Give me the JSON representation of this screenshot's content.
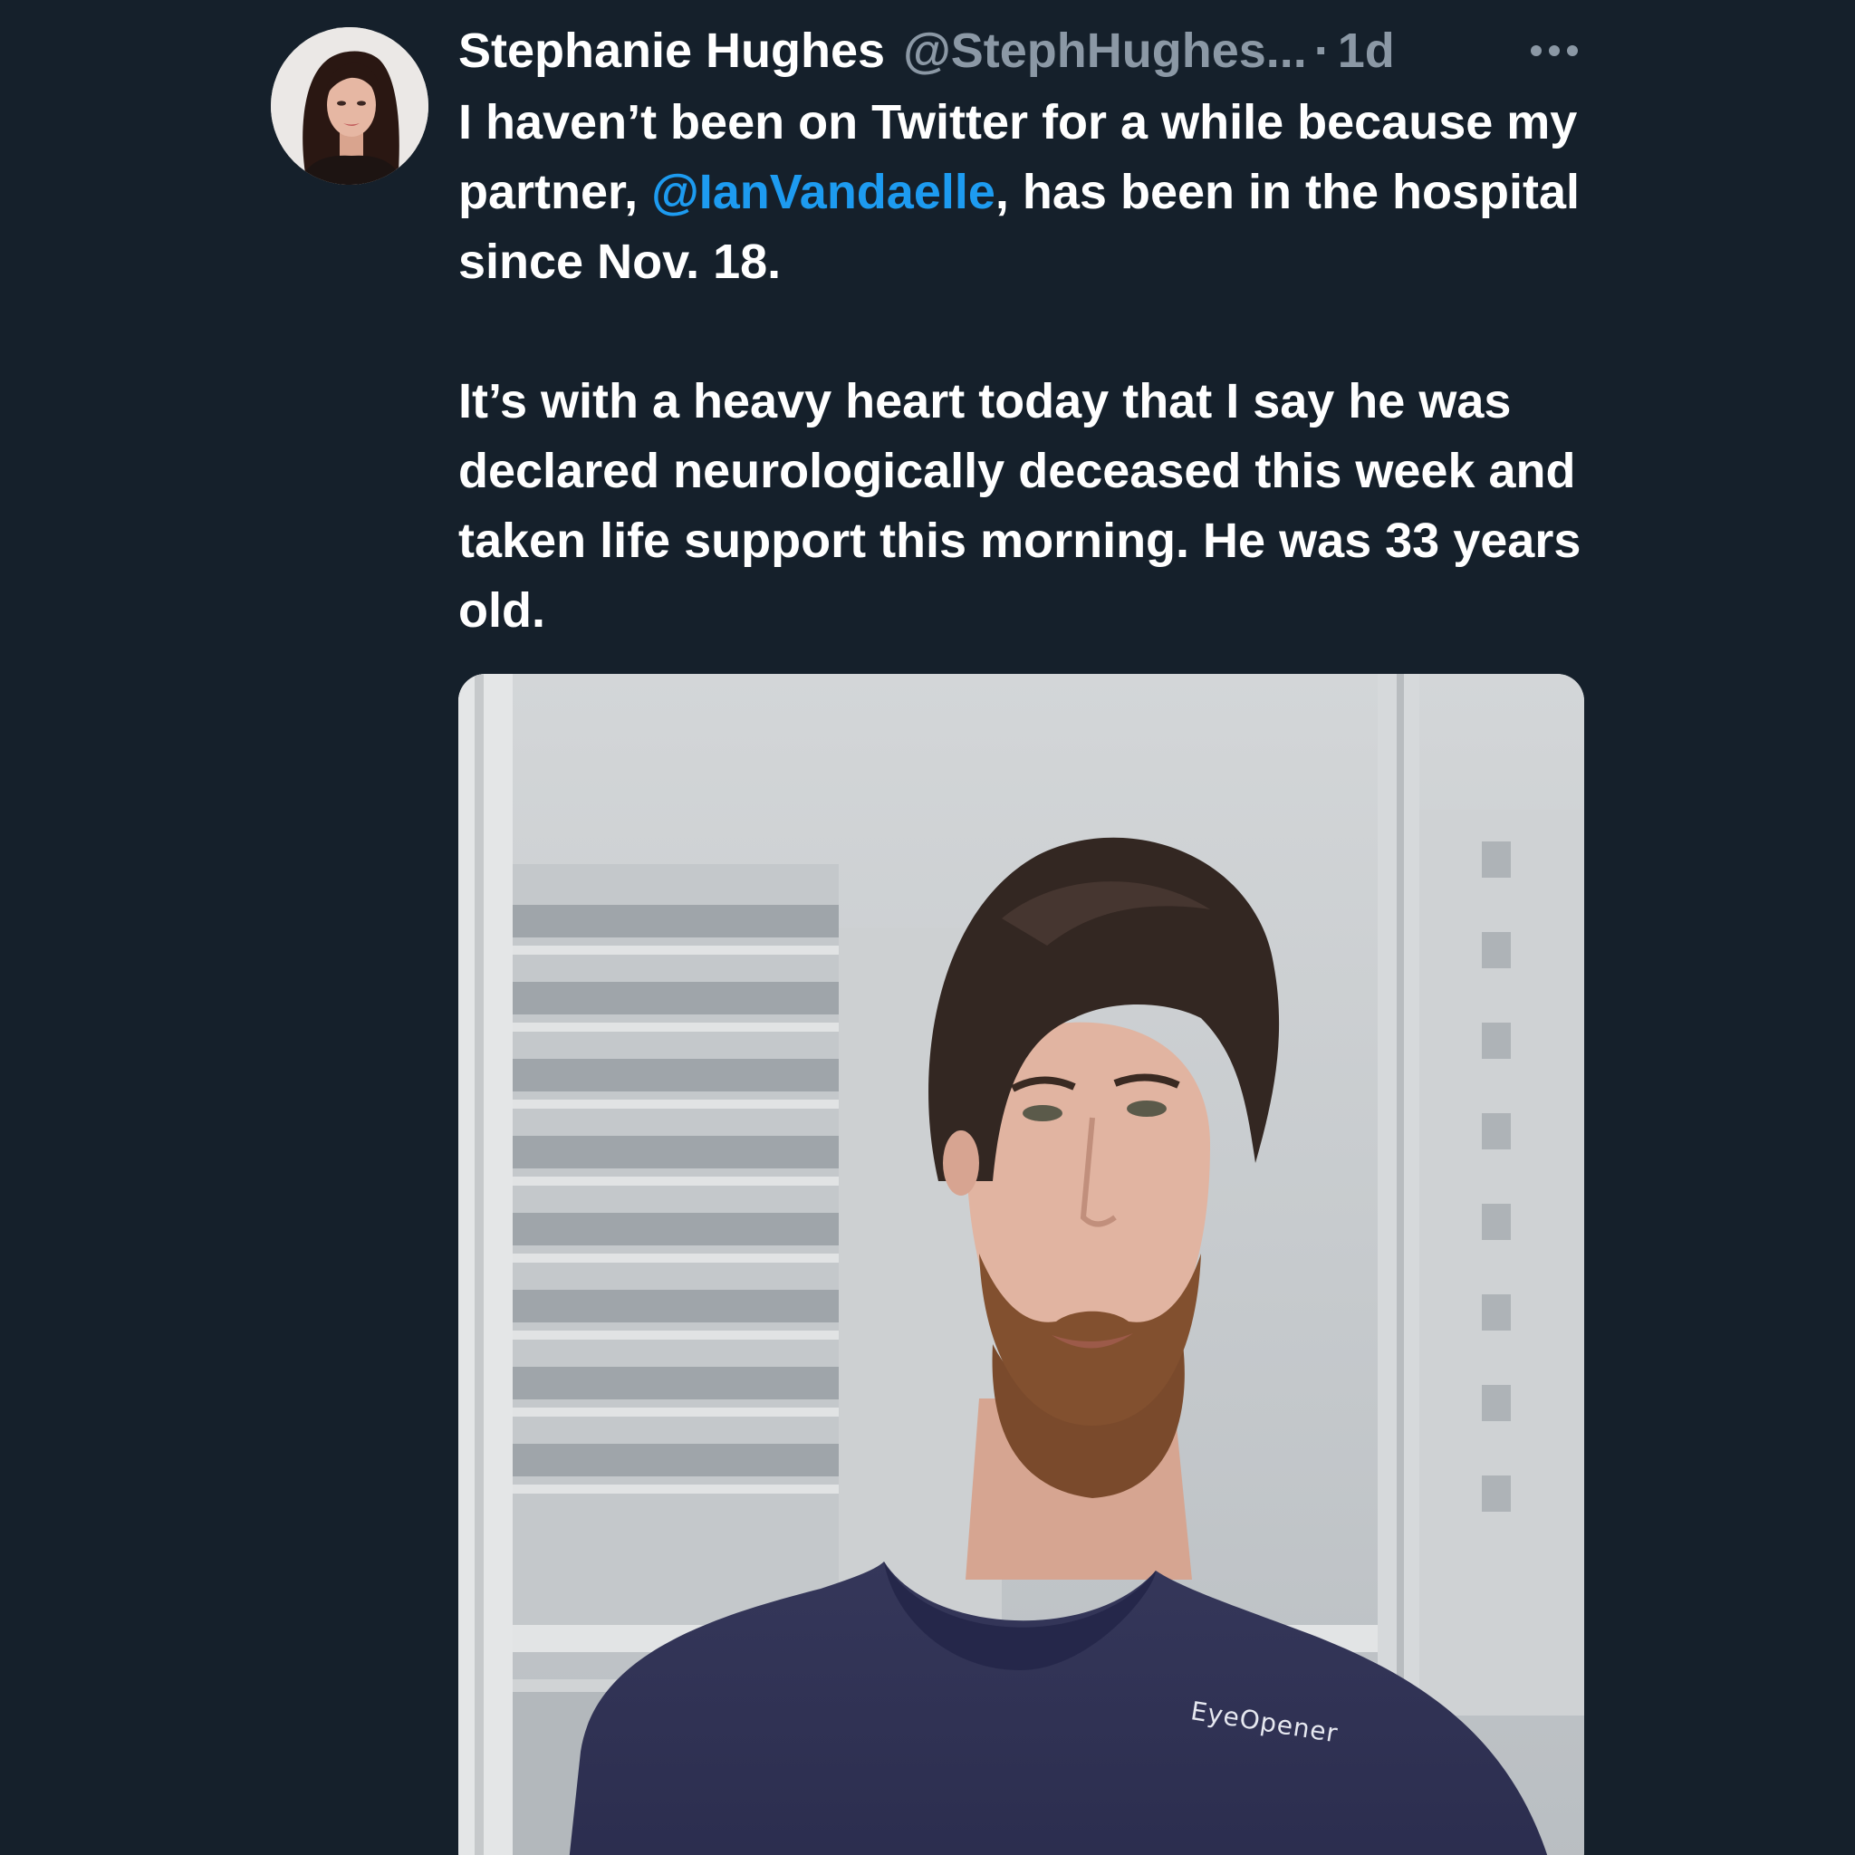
{
  "tweet": {
    "author": {
      "display_name": "Stephanie Hughes",
      "handle": "@StephHughes...",
      "separator": "·",
      "time": "1d",
      "avatar_icon": "profile-photo-woman"
    },
    "more_icon": "more-options-icon",
    "text": {
      "line1_part1": "I haven’t been on Twitter for a while because my partner, ",
      "mention": "@IanVandaelle",
      "line1_part2": ", has been in the hospital since Nov. 18.",
      "paragraph2": "It’s with a heavy heart today that I say he was declared neurologically deceased this week and taken life support this morning. He was 33 years old."
    },
    "media": {
      "shirt_text": "EyeOpener"
    }
  },
  "colors": {
    "background": "#15202b",
    "text_primary": "#ffffff",
    "text_secondary": "#8b98a5",
    "link": "#1d9bf0"
  }
}
